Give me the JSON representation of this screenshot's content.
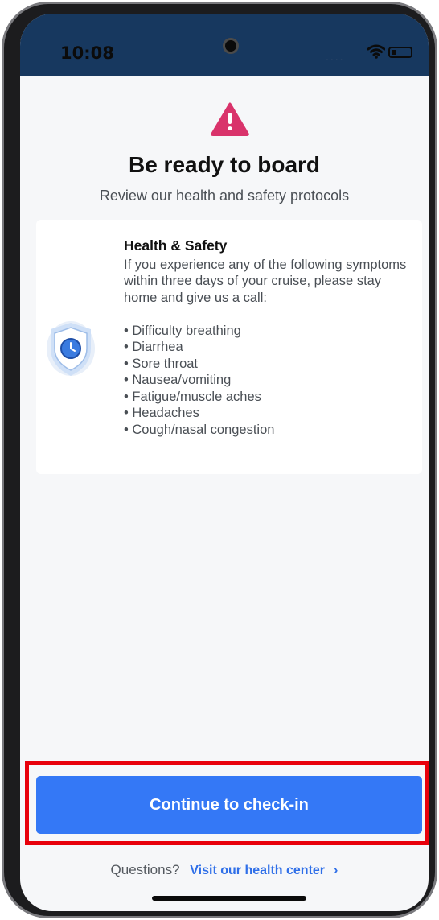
{
  "status_bar": {
    "time": "10:08",
    "signal_dots": "....",
    "wifi_icon": "wifi-icon",
    "battery_icon": "battery-icon"
  },
  "header": {
    "icon": "warning-triangle-icon",
    "title": "Be ready to board",
    "subtitle": "Review our health and safety protocols"
  },
  "card": {
    "icon": "shield-clock-icon",
    "title": "Health & Safety",
    "body": "If you experience any of the following symptoms within three days of your cruise, please stay home and give us a call:",
    "symptoms": [
      "Difficulty breathing",
      "Diarrhea",
      "Sore throat",
      "Nausea/vomiting",
      "Fatigue/muscle aches",
      "Headaches",
      "Cough/nasal congestion"
    ]
  },
  "footer": {
    "continue_label": "Continue to check-in",
    "questions_label": "Questions?",
    "health_link_label": "Visit our health center",
    "health_link_chevron": "›"
  },
  "colors": {
    "status_bar": "#17385f",
    "screen_bg": "#f6f7f9",
    "accent": "#3478f6",
    "warning": "#d9336b",
    "highlight": "#e8000b"
  }
}
